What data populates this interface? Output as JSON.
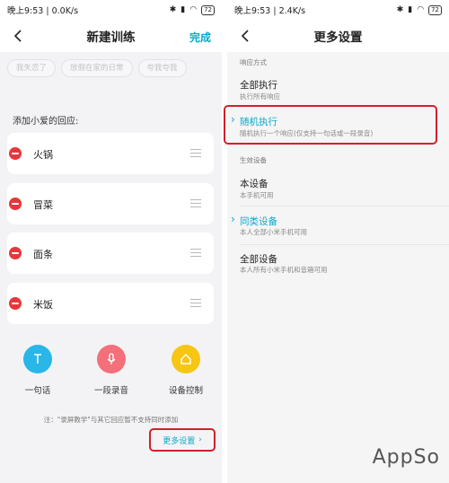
{
  "left": {
    "status": {
      "time": "晚上9:53",
      "speed": "0.0K/s",
      "battery": "72"
    },
    "title": "新建训练",
    "done_label": "完成",
    "suggestion_chips": [
      "我失恋了",
      "放假在家的日常",
      "夸我夸我"
    ],
    "section_label": "添加小爱的回应:",
    "responses": [
      {
        "label": "火锅"
      },
      {
        "label": "冒菜"
      },
      {
        "label": "面条"
      },
      {
        "label": "米饭"
      }
    ],
    "actions": [
      {
        "label": "一句话",
        "icon": "text-icon",
        "color": "#29b6e9"
      },
      {
        "label": "一段录音",
        "icon": "microphone-icon",
        "color": "#f36f7a"
      },
      {
        "label": "设备控制",
        "icon": "home-icon",
        "color": "#f7c614"
      }
    ],
    "note": "注：\"录屏教学\"与其它回应暂不支持同时添加",
    "more_settings_label": "更多设置"
  },
  "right": {
    "status": {
      "time": "晚上9:53",
      "speed": "2.4K/s",
      "battery": "72"
    },
    "title": "更多设置",
    "response_section": "响应方式",
    "response_options": [
      {
        "title": "全部执行",
        "subtitle": "执行所有响应",
        "selected": false
      },
      {
        "title": "随机执行",
        "subtitle": "随机执行一个响应(仅支持一句话或一段录音)",
        "selected": true
      }
    ],
    "device_section": "生效设备",
    "device_options": [
      {
        "title": "本设备",
        "subtitle": "本手机可用",
        "selected": false
      },
      {
        "title": "同类设备",
        "subtitle": "本人全部小米手机可用",
        "selected": true
      },
      {
        "title": "全部设备",
        "subtitle": "本人所有小米手机和音箱可用",
        "selected": false
      }
    ]
  },
  "colors": {
    "accent": "#0aa9c9",
    "delete": "#e5383b",
    "highlight_box": "#d0202a"
  },
  "watermark": "AppSo"
}
